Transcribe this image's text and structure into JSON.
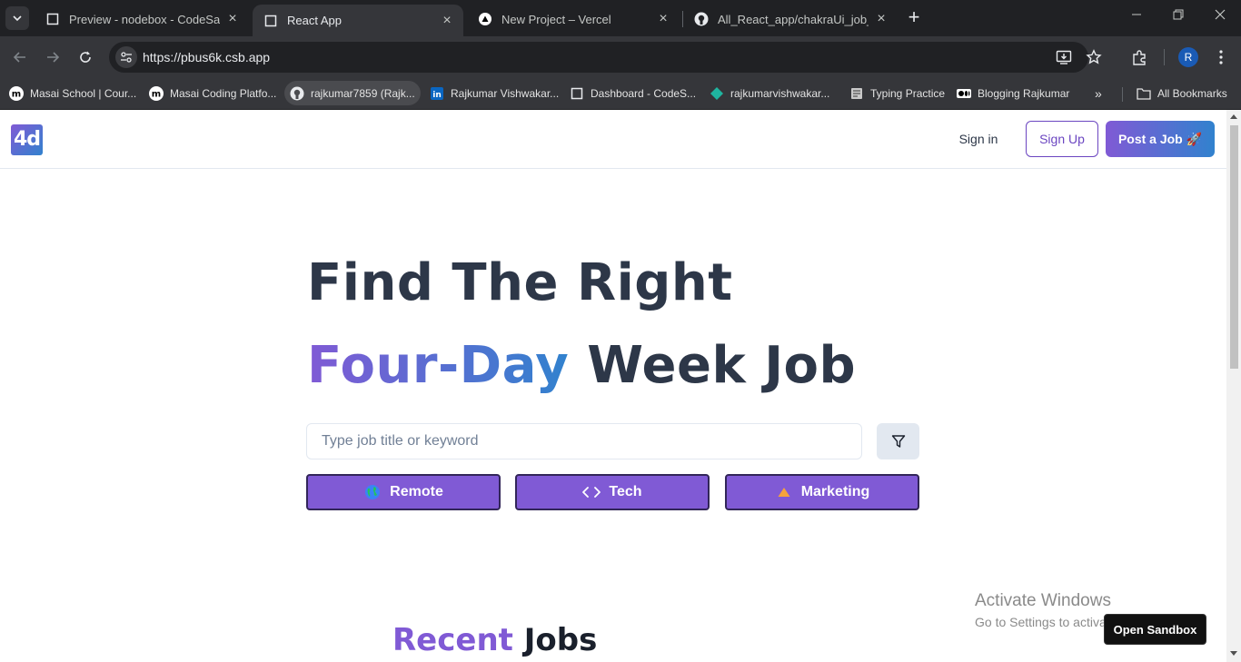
{
  "browser": {
    "tabs": [
      {
        "title": "Preview - nodebox - CodeSandbox",
        "active": false
      },
      {
        "title": "React App",
        "active": true
      },
      {
        "title": "New Project – Vercel",
        "active": false
      },
      {
        "title": "All_React_app/chakraUi_job_lear",
        "active": false
      }
    ],
    "url": "https://pbus6k.csb.app",
    "profile_initial": "R",
    "bookmarks": [
      {
        "label": "Masai School | Cour...",
        "icon": "masai-icon"
      },
      {
        "label": "Masai Coding Platfo...",
        "icon": "masai-icon"
      },
      {
        "label": "rajkumar7859 (Rajk...",
        "icon": "github-icon"
      },
      {
        "label": "Rajkumar Vishwakar...",
        "icon": "linkedin-icon"
      },
      {
        "label": "Dashboard - CodeS...",
        "icon": "codesandbox-icon"
      },
      {
        "label": "rajkumarvishwakar...",
        "icon": "diamond-icon"
      },
      {
        "label": "Typing Practice",
        "icon": "typing-icon"
      },
      {
        "label": "Blogging Rajkumar",
        "icon": "medium-icon"
      }
    ],
    "bookmarks_overflow": "»",
    "all_bookmarks": "All Bookmarks"
  },
  "app": {
    "logo": "4d",
    "nav": {
      "sign_in": "Sign in",
      "sign_up": "Sign Up",
      "post_job": "Post a Job 🚀"
    },
    "hero": {
      "line1": "Find The Right",
      "highlight": "Four-Day",
      "line2_rest": "Week Job"
    },
    "search": {
      "placeholder": "Type job title or keyword"
    },
    "categories": [
      {
        "label": "Remote",
        "icon": "globe-icon"
      },
      {
        "label": "Tech",
        "icon": "code-icon"
      },
      {
        "label": "Marketing",
        "icon": "triangle-icon"
      }
    ],
    "recent": {
      "highlight": "Recent",
      "rest": "Jobs"
    }
  },
  "overlay": {
    "activate_title": "Activate Windows",
    "activate_sub": "Go to Settings to activate Windows.",
    "open_sandbox": "Open Sandbox"
  },
  "colors": {
    "brand_purple": "#805ad5",
    "brand_blue": "#3182ce",
    "heading": "#2d3748"
  }
}
